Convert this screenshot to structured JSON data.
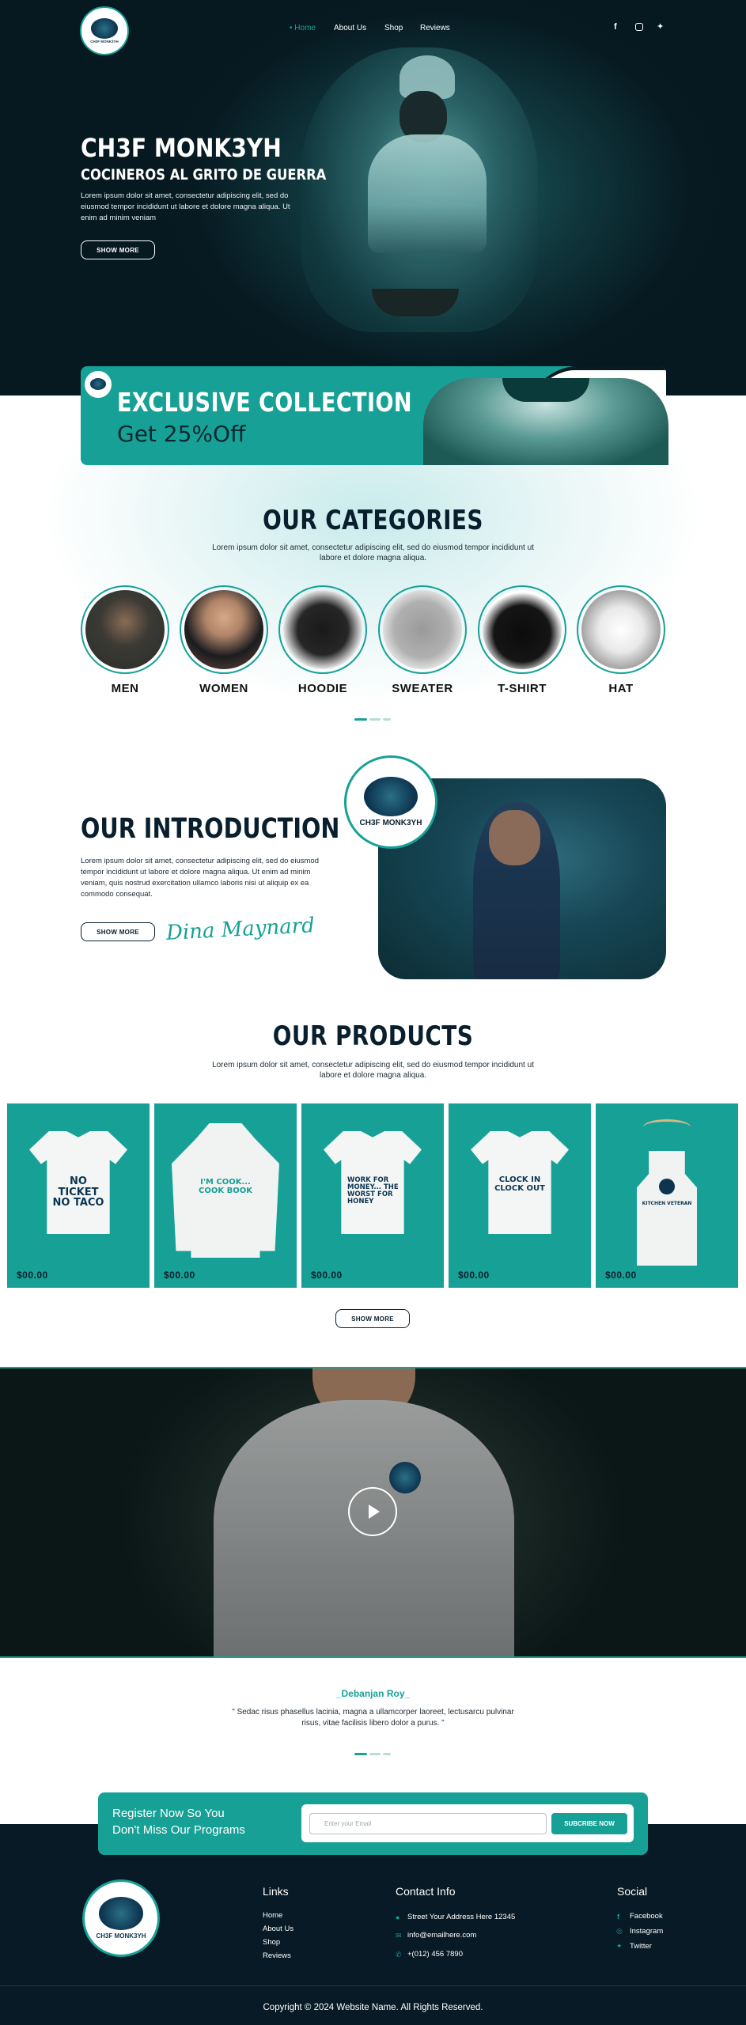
{
  "header": {
    "logo_text": "CH3F MONK3YH",
    "nav": [
      "Home",
      "About Us",
      "Shop",
      "Reviews"
    ],
    "social_icons": [
      "facebook-icon",
      "instagram-icon",
      "twitter-icon"
    ]
  },
  "hero": {
    "title": "CH3F MONK3YH",
    "subtitle": "COCINEROS AL GRITO DE GUERRA",
    "text": "Lorem ipsum dolor sit amet, consectetur adipiscing elit, sed do eiusmod tempor incididunt ut labore et dolore magna aliqua. Ut enim ad minim veniam",
    "button": "SHOW MORE"
  },
  "promo": {
    "title": "EXCLUSIVE COLLECTION",
    "subtitle": "Get 25%Off"
  },
  "categories": {
    "title": "OUR CATEGORIES",
    "desc": "Lorem ipsum dolor sit amet, consectetur adipiscing elit, sed do eiusmod tempor incididunt ut labore et dolore magna aliqua.",
    "items": [
      "MEN",
      "WOMEN",
      "HOODIE",
      "SWEATER",
      "T-SHIRT",
      "HAT"
    ]
  },
  "intro": {
    "title": "OUR INTRODUCTION",
    "text": "Lorem ipsum dolor sit amet, consectetur adipiscing elit, sed do eiusmod tempor incididunt ut labore et dolore magna aliqua. Ut enim ad minim veniam, quis nostrud exercitation ullamco laboris nisi ut aliquip ex ea commodo consequat.",
    "button": "SHOW MORE",
    "signature": "Dina Maynard",
    "badge": "CH3F MONK3YH"
  },
  "products": {
    "title": "OUR PRODUCTS",
    "desc": "Lorem ipsum dolor sit amet, consectetur adipiscing elit, sed do eiusmod tempor incididunt ut labore et dolore magna aliqua.",
    "items": [
      {
        "print": "NO TICKET NO TACO",
        "price": "$00.00"
      },
      {
        "print": "I'M COOK... COOK BOOK",
        "price": "$00.00"
      },
      {
        "print": "WORK FOR MONEY... THE WORST FOR HONEY",
        "price": "$00.00"
      },
      {
        "print": "CLOCK IN CLOCK OUT",
        "price": "$00.00"
      },
      {
        "print": "KITCHEN VETERAN",
        "price": "$00.00"
      }
    ],
    "button": "SHOW MORE"
  },
  "testimonial": {
    "name": "_Debanjan Roy_",
    "quote": "\" Sedac risus phasellus lacinia, magna a ullamcorper laoreet, lectusarcu pulvinar risus, vitae facilisis libero dolor a purus. \""
  },
  "newsletter": {
    "line1": "Register Now So You",
    "line2": "Don't Miss Our Programs",
    "placeholder": "Enter your Email",
    "button": "SUBCRIBE NOW"
  },
  "footer": {
    "links_title": "Links",
    "links": [
      "Home",
      "About Us",
      "Shop",
      "Reviews"
    ],
    "contact_title": "Contact Info",
    "contact": [
      "Street Your Address Here 12345",
      "info@emailhere.com",
      "+(012) 456 7890"
    ],
    "social_title": "Social",
    "social": [
      "Facebook",
      "Instagram",
      "Twitter"
    ],
    "copyright": "Copyright © 2024 Website Name. All Rights Reserved."
  },
  "colors": {
    "accent": "#17a196",
    "dark": "#071a25"
  }
}
